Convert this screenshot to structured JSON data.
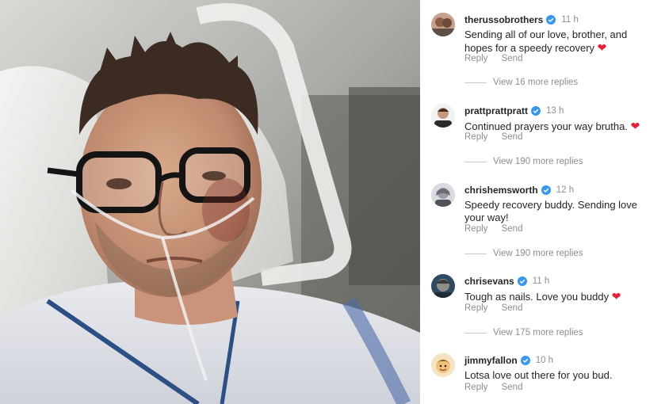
{
  "photo": {
    "description_icon": "selfie-photo"
  },
  "comments": [
    {
      "username": "therussobrothers",
      "time": "11 h",
      "text": "Sending all of our love, brother, and hopes for a speedy recovery",
      "has_heart": true,
      "reply_label": "Reply",
      "send_label": "Send",
      "view_replies": "View 16 more replies"
    },
    {
      "username": "prattprattpratt",
      "time": "13 h",
      "text": "Continued prayers your way brutha.",
      "has_heart": true,
      "reply_label": "Reply",
      "send_label": "Send",
      "view_replies": "View 190 more replies"
    },
    {
      "username": "chrishemsworth",
      "time": "12 h",
      "text": "Speedy recovery buddy. Sending love your way!",
      "has_heart": false,
      "reply_label": "Reply",
      "send_label": "Send",
      "view_replies": "View 190 more replies"
    },
    {
      "username": "chrisevans",
      "time": "11 h",
      "text": "Tough as nails. Love you buddy",
      "has_heart": true,
      "reply_label": "Reply",
      "send_label": "Send",
      "view_replies": "View 175 more replies"
    },
    {
      "username": "jimmyfallon",
      "time": "10 h",
      "text": "Lotsa love out there for you bud.",
      "has_heart": false,
      "reply_label": "Reply",
      "send_label": "Send"
    }
  ],
  "icons": {
    "verified": "verified-badge-icon",
    "heart": "red-heart-emoji"
  },
  "colors": {
    "verified_blue": "#3897f0",
    "heart_red": "#ed1c3a",
    "muted_text": "#8e8e8e",
    "primary_text": "#262626"
  }
}
